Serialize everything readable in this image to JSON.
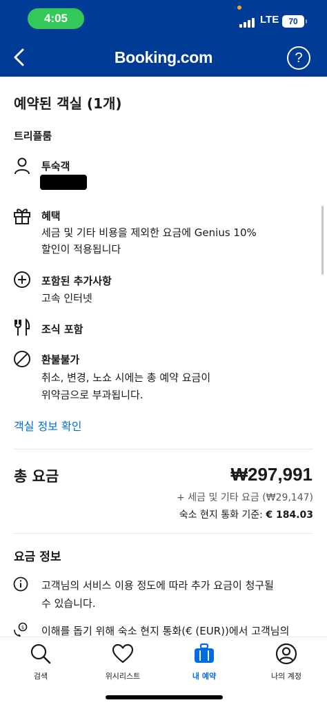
{
  "status_bar": {
    "time": "4:05",
    "network": "LTE",
    "battery": "70"
  },
  "header": {
    "brand": "Booking.com",
    "help_icon": "question-circle-icon",
    "back_icon": "chevron-left-icon"
  },
  "room_section": {
    "title": "예약된 객실 (1개)",
    "room_name": "트리플룸",
    "features": [
      {
        "icon": "person-icon",
        "title": "투숙객",
        "desc": ""
      },
      {
        "icon": "gift-icon",
        "title": "혜택",
        "desc_lines": [
          "세금 및 기타 비용을 제외한 요금에 Genius 10%",
          "할인이 적용됩니다"
        ]
      },
      {
        "icon": "plus-circle-icon",
        "title": "포함된 추가사항",
        "desc_lines": [
          "고속 인터넷"
        ]
      },
      {
        "icon": "fork-knife-icon",
        "title": "조식 포함"
      },
      {
        "icon": "no-entry-icon",
        "title": "환불불가",
        "desc_lines": [
          "취소, 변경, 노쇼 시에는 총 예약 요금이",
          "위약금으로 부과됩니다."
        ]
      }
    ],
    "link": "객실 정보 확인"
  },
  "total": {
    "label": "총 요금",
    "amount": "₩297,991",
    "tax_line": "+ 세금 및 기타 요금 (₩29,147)",
    "local_prefix": "숙소 현지 통화 기준: ",
    "local_amount": "€ 184.03"
  },
  "price_info": {
    "title": "요금 정보",
    "items": [
      {
        "icon": "info-circle-icon",
        "lines": [
          "고객님의 서비스 이용 정도에 따라 추가 요금이 청구될",
          "수 있습니다."
        ]
      },
      {
        "icon": "currency-exchange-icon",
        "lines": [
          "이해를 돕기 위해 숙소 현지 통화(€ (EUR))에서 고객님의"
        ]
      }
    ]
  },
  "bottom_nav": {
    "items": [
      {
        "label": "검색",
        "icon": "search-icon",
        "active": false
      },
      {
        "label": "위시리스트",
        "icon": "heart-icon",
        "active": false
      },
      {
        "label": "내 예약",
        "icon": "suitcase-icon",
        "active": true
      },
      {
        "label": "나의 계정",
        "icon": "account-icon",
        "active": false
      }
    ]
  },
  "colors": {
    "brand_blue": "#003b95",
    "link_blue": "#006ce4",
    "status_green": "#34c759"
  }
}
